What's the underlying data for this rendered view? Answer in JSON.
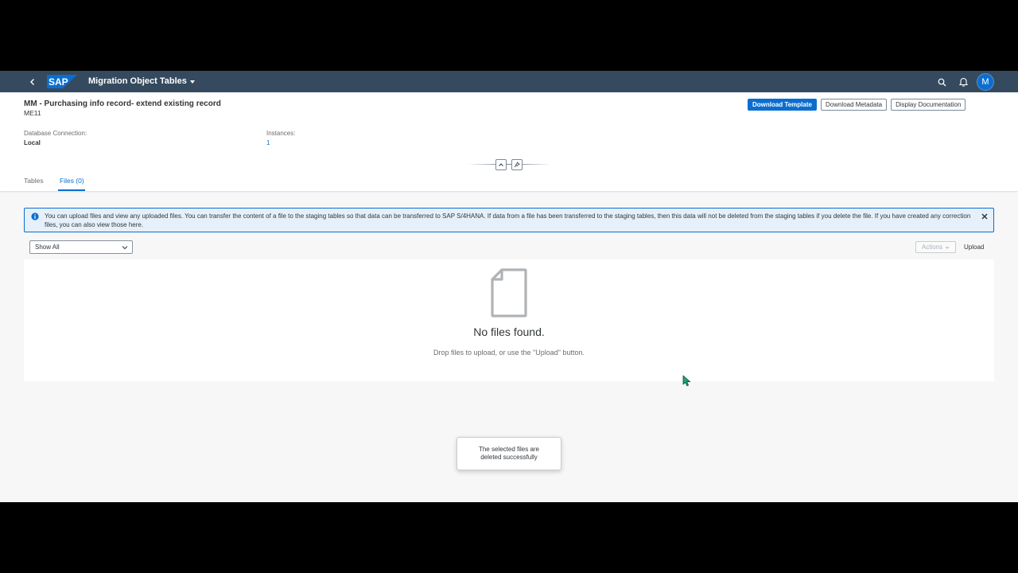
{
  "shellbar": {
    "logo_text": "SAP",
    "title": "Migration Object Tables",
    "avatar_initial": "M",
    "icons": [
      "back-icon",
      "search-icon",
      "bell-icon"
    ]
  },
  "header": {
    "title": "MM - Purchasing info record- extend existing record",
    "subtitle": "ME11",
    "buttons": {
      "download_template": "Download Template",
      "download_metadata": "Download Metadata",
      "display_documentation": "Display Documentation"
    },
    "attributes": {
      "db_connection_label": "Database Connection:",
      "db_connection_value": "Local",
      "instances_label": "Instances:",
      "instances_value": "1"
    },
    "tabs": [
      {
        "label": "Tables",
        "active": false
      },
      {
        "label": "Files (0)",
        "active": true
      }
    ]
  },
  "message_strip": {
    "text": "You can upload files and view any uploaded files. You can transfer the content of a file to the staging tables so that data can be transferred to SAP S/4HANA. If data from a file has been transferred to the staging tables, then this data will not be deleted from the staging tables if you delete the file. If you have created any correction files, you can also view those here."
  },
  "toolbar": {
    "filter_value": "Show All",
    "actions_label": "Actions",
    "upload_label": "Upload"
  },
  "upload_area": {
    "title": "No files found.",
    "description": "Drop files to upload, or use the \"Upload\" button."
  },
  "toast": {
    "message": "The selected files are deleted successfully"
  },
  "colors": {
    "shell": "#354a5f",
    "accent": "#0a6ed1",
    "background": "#f7f7f7",
    "info_bg": "#e5f0fa"
  }
}
